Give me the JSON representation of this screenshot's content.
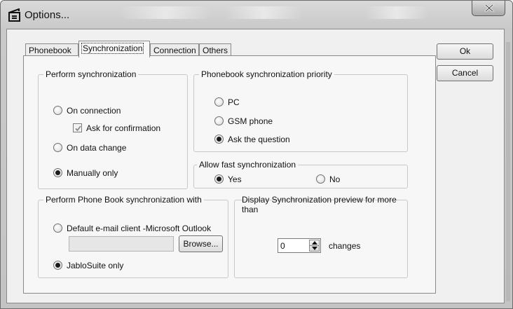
{
  "window": {
    "title": "Options...",
    "icon": "phone-sync-app-icon",
    "close_label": "X"
  },
  "tabs": [
    {
      "label": "Phonebook",
      "active": false
    },
    {
      "label": "Synchronization",
      "active": true
    },
    {
      "label": "Connection",
      "active": false
    },
    {
      "label": "Others",
      "active": false
    }
  ],
  "buttons": {
    "ok": "Ok",
    "cancel": "Cancel",
    "browse": "Browse..."
  },
  "perform_sync": {
    "title": "Perform synchronization",
    "on_connection": "On connection",
    "ask_confirmation": "Ask for confirmation",
    "on_data_change": "On data change",
    "manually_only": "Manually only",
    "selected": "Manually only",
    "ask_confirmation_checked": true
  },
  "priority": {
    "title": "Phonebook synchronization priority",
    "pc": "PC",
    "gsm_phone": "GSM phone",
    "ask_question": "Ask the question",
    "selected": "Ask the question"
  },
  "fast_sync": {
    "title": "Allow fast synchronization",
    "yes": "Yes",
    "no": "No",
    "selected": "Yes"
  },
  "phonebook_sync_with": {
    "title": "Perform Phone Book synchronization with",
    "default_client": "Default e-mail client -Microsoft Outlook",
    "jablosuite_only": "JabloSuite only",
    "selected": "JabloSuite only",
    "path_value": ""
  },
  "preview": {
    "title": "Display Synchronization preview for more than",
    "value": "0",
    "unit": "changes"
  }
}
